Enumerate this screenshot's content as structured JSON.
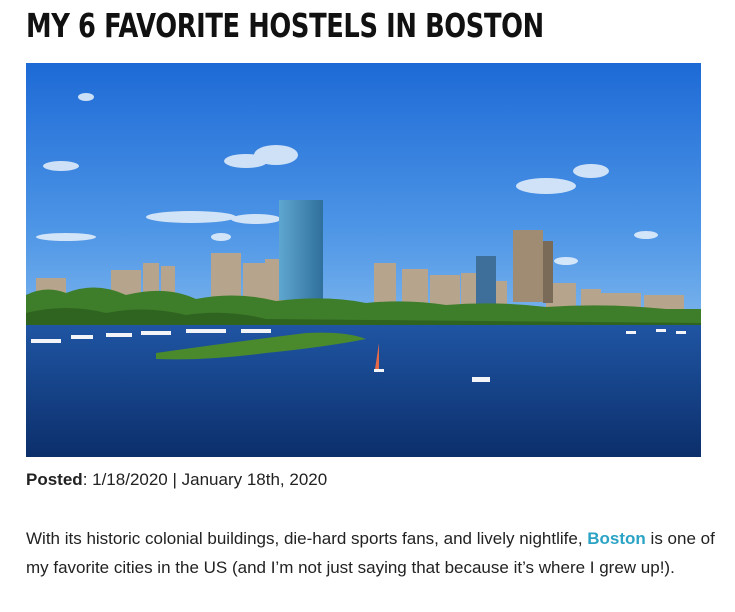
{
  "article": {
    "title": "MY 6 FAVORITE HOSTELS IN BOSTON",
    "hero_image": {
      "subject": "boston-skyline-charles-river-photo"
    },
    "meta": {
      "posted_label": "Posted",
      "posted_value": ": 1/18/2020 | January 18th, 2020"
    },
    "intro": {
      "before_link": "With its historic colonial buildings, die-hard sports fans, and lively nightlife, ",
      "link_text": "Boston",
      "after_link": " is one of my favorite cities in the US (and I’m not just saying that because it’s where I grew up!)."
    }
  },
  "colors": {
    "link": "#2aa3c5",
    "sky_top": "#1f6fd8",
    "sky_bottom": "#6fb1ee",
    "water": "#123f86",
    "trees": "#3e7d2a"
  }
}
